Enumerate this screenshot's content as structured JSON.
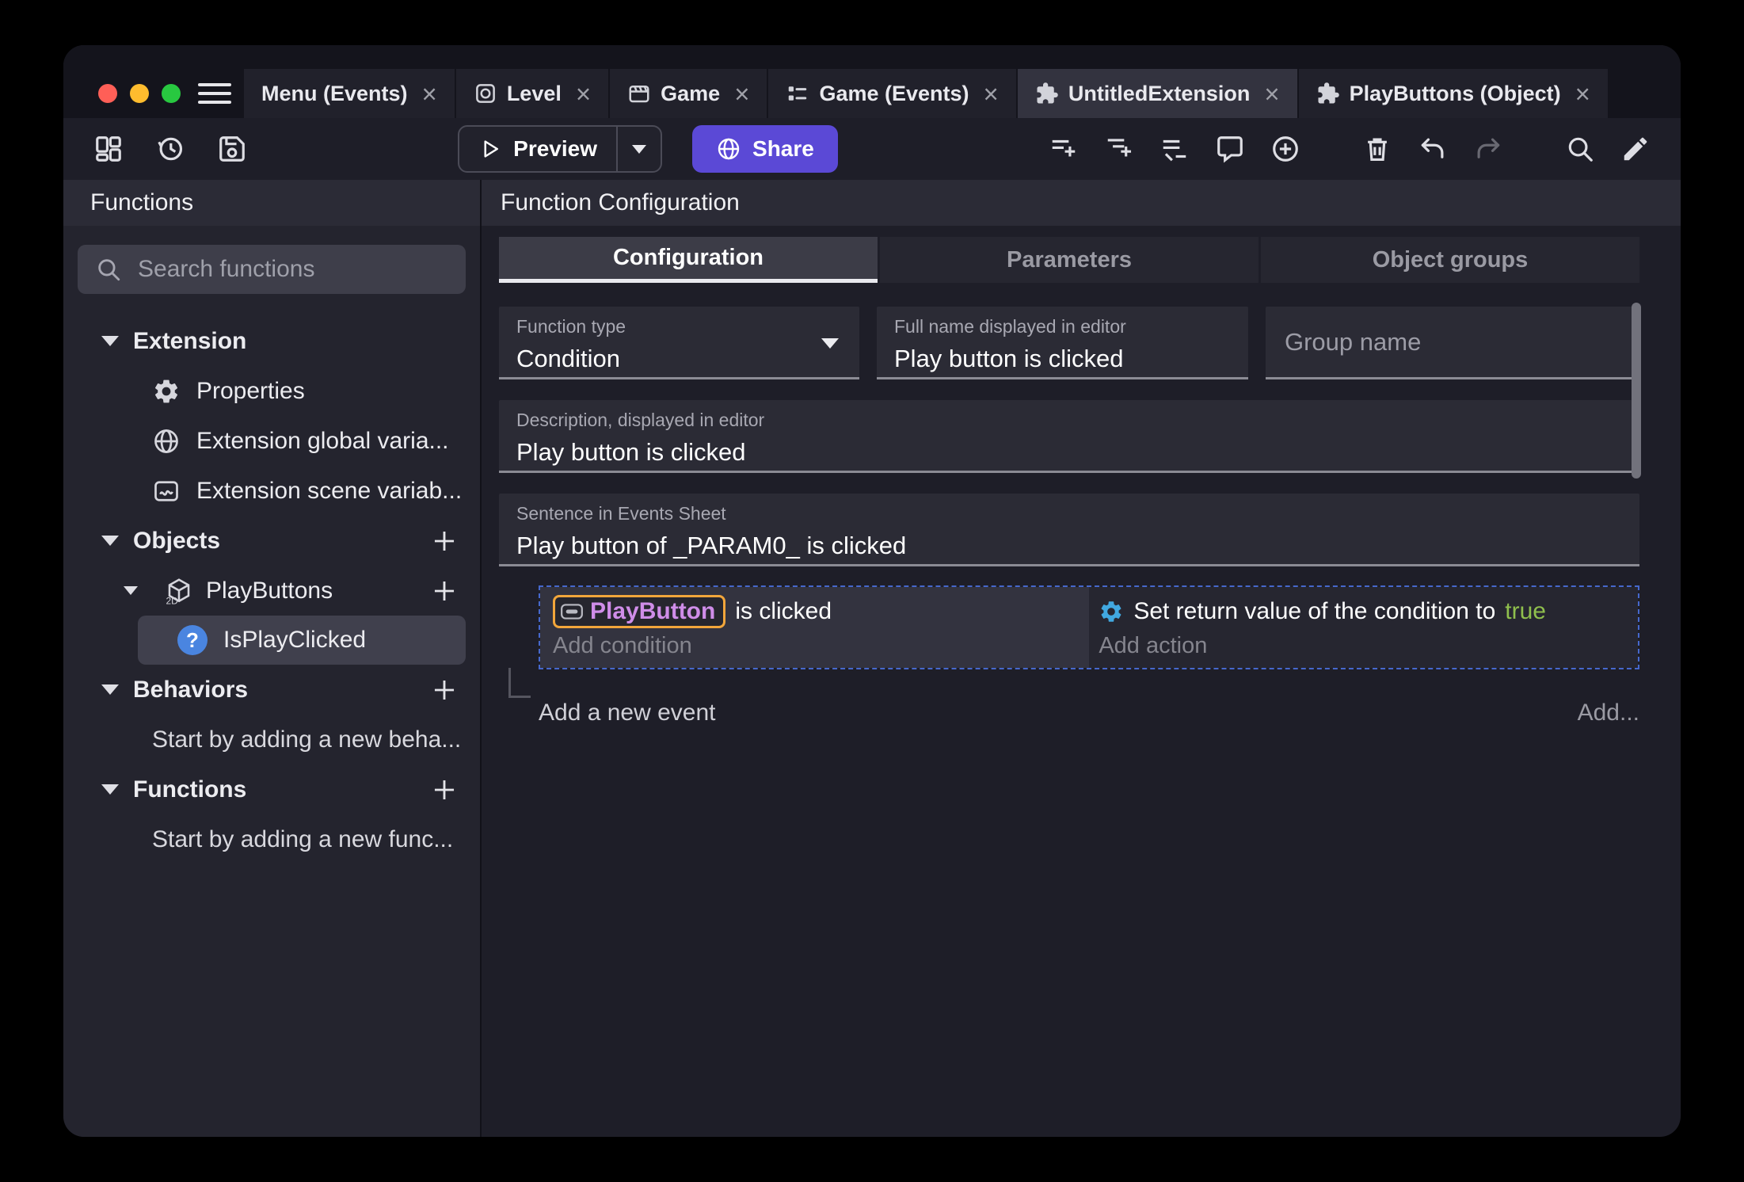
{
  "colors": {
    "accent_purple": "#5b49d6",
    "selection_orange": "#f2a63b",
    "object_name_purple": "#cf8de8",
    "boolean_true_green": "#8fbf4d",
    "action_gear_blue": "#41a8e0",
    "selected_event_dashed_blue": "#4668cc"
  },
  "tabs": [
    {
      "label": "Menu (Events)",
      "icon": "",
      "close": "×"
    },
    {
      "label": "Level",
      "icon": "scene-icon",
      "close": "×"
    },
    {
      "label": "Game",
      "icon": "clapperboard-icon",
      "close": "×"
    },
    {
      "label": "Game (Events)",
      "icon": "events-list-icon",
      "close": "×"
    },
    {
      "label": "UntitledExtension",
      "icon": "extension-puzzle-icon",
      "close": "×",
      "active": true
    },
    {
      "label": "PlayButtons (Object)",
      "icon": "extension-puzzle-icon",
      "close": "×"
    }
  ],
  "toolbar": {
    "preview": "Preview",
    "share": "Share",
    "icons": [
      "project-manager-icon",
      "history-icon",
      "save-icon",
      "add-event-icon",
      "add-subevent-icon",
      "remove-event-icon",
      "comment-icon",
      "add-circle-icon",
      "trash-icon",
      "undo-icon",
      "redo-icon",
      "search-icon",
      "edit-pen-icon"
    ]
  },
  "sidebar": {
    "header": "Functions",
    "search_placeholder": "Search functions",
    "tree": {
      "extension_section": "Extension",
      "properties": "Properties",
      "global_vars": "Extension global varia...",
      "scene_vars": "Extension scene variab...",
      "objects_section": "Objects",
      "playbuttons": "PlayButtons",
      "is_play_clicked": "IsPlayClicked",
      "behaviors_section": "Behaviors",
      "behaviors_hint": "Start by adding a new beha...",
      "functions_section": "Functions",
      "functions_hint": "Start by adding a new func..."
    }
  },
  "main": {
    "header": "Function Configuration",
    "tabs": [
      "Configuration",
      "Parameters",
      "Object groups"
    ],
    "function_type_label": "Function type",
    "function_type_value": "Condition",
    "full_name_label": "Full name displayed in editor",
    "full_name_value": "Play button is clicked",
    "group_name_placeholder": "Group name",
    "description_label": "Description, displayed in editor",
    "description_value": "Play button is clicked",
    "sentence_label": "Sentence in Events Sheet",
    "sentence_value": "Play button of _PARAM0_ is clicked",
    "event": {
      "condition_object": "PlayButton",
      "condition_text": "is clicked",
      "add_condition": "Add condition",
      "action_text": "Set return value of the condition to",
      "action_value": "true",
      "add_action": "Add action"
    },
    "add_new_event": "Add a new event",
    "add_more": "Add..."
  }
}
